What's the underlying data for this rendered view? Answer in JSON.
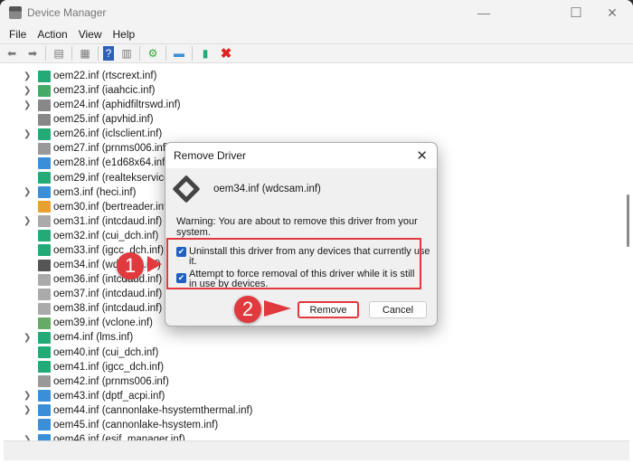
{
  "window": {
    "title": "Device Manager",
    "minimize": "—",
    "maximize": "☐",
    "close": "✕"
  },
  "menu": [
    "File",
    "Action",
    "View",
    "Help"
  ],
  "toolbar": [
    "back-icon",
    "forward-icon",
    "show-hide-console-tree-icon",
    "properties-icon",
    "help-icon",
    "action-pane-icon",
    "scan-hardware-icon",
    "monitor-icon",
    "update-driver-icon",
    "remove-icon"
  ],
  "tree": [
    {
      "label": "oem22.inf (rtscrext.inf)",
      "exp": true,
      "icon": "#2a7"
    },
    {
      "label": "oem23.inf (iaahcic.inf)",
      "exp": true,
      "icon": "#4a6"
    },
    {
      "label": "oem24.inf (aphidfiltrswd.inf)",
      "exp": true,
      "icon": "#888"
    },
    {
      "label": "oem25.inf (apvhid.inf)",
      "exp": false,
      "icon": "#888"
    },
    {
      "label": "oem26.inf (iclsclient.inf)",
      "exp": true,
      "icon": "#2a7"
    },
    {
      "label": "oem27.inf (prnms006.inf)",
      "exp": false,
      "icon": "#999"
    },
    {
      "label": "oem28.inf (e1d68x64.inf)",
      "exp": false,
      "icon": "#3a8fd8"
    },
    {
      "label": "oem29.inf (realtekservice.inf)",
      "exp": false,
      "icon": "#2a7"
    },
    {
      "label": "oem3.inf (heci.inf)",
      "exp": true,
      "icon": "#3a8fd8"
    },
    {
      "label": "oem30.inf (bertreader.inf)",
      "exp": false,
      "icon": "#e8a030"
    },
    {
      "label": "oem31.inf (intcdaud.inf)",
      "exp": true,
      "icon": "#aaa"
    },
    {
      "label": "oem32.inf (cui_dch.inf)",
      "exp": false,
      "icon": "#2a7"
    },
    {
      "label": "oem33.inf (igcc_dch.inf)",
      "exp": false,
      "icon": "#2a7"
    },
    {
      "label": "oem34.inf (wdcsam.inf)",
      "exp": false,
      "icon": "#555"
    },
    {
      "label": "oem36.inf (intcdaud.inf)",
      "exp": false,
      "icon": "#aaa"
    },
    {
      "label": "oem37.inf (intcdaud.inf)",
      "exp": false,
      "icon": "#aaa"
    },
    {
      "label": "oem38.inf (intcdaud.inf)",
      "exp": false,
      "icon": "#aaa"
    },
    {
      "label": "oem39.inf (vclone.inf)",
      "exp": false,
      "icon": "#6a6"
    },
    {
      "label": "oem4.inf (lms.inf)",
      "exp": true,
      "icon": "#2a7"
    },
    {
      "label": "oem40.inf (cui_dch.inf)",
      "exp": false,
      "icon": "#2a7"
    },
    {
      "label": "oem41.inf (igcc_dch.inf)",
      "exp": false,
      "icon": "#2a7"
    },
    {
      "label": "oem42.inf (prnms006.inf)",
      "exp": false,
      "icon": "#999"
    },
    {
      "label": "oem43.inf (dptf_acpi.inf)",
      "exp": true,
      "icon": "#3a8fd8"
    },
    {
      "label": "oem44.inf (cannonlake-hsystemthermal.inf)",
      "exp": true,
      "icon": "#3a8fd8"
    },
    {
      "label": "oem45.inf (cannonlake-hsystem.inf)",
      "exp": false,
      "icon": "#3a8fd8"
    },
    {
      "label": "oem46.inf (esif_manager.inf)",
      "exp": true,
      "icon": "#3a8fd8"
    }
  ],
  "dialog": {
    "title": "Remove Driver",
    "close": "✕",
    "driver": "oem34.inf (wdcsam.inf)",
    "warning": "Warning: You are about to remove this driver from your system.",
    "option1": {
      "label": "Uninstall this driver from any devices that currently use it.",
      "checked": true
    },
    "option2": {
      "label": "Attempt to force removal of this driver while it is still in use by devices.",
      "checked": true
    },
    "remove": "Remove",
    "cancel": "Cancel"
  },
  "annotations": {
    "step1": "1",
    "step2": "2",
    "color": "#e0393e"
  }
}
